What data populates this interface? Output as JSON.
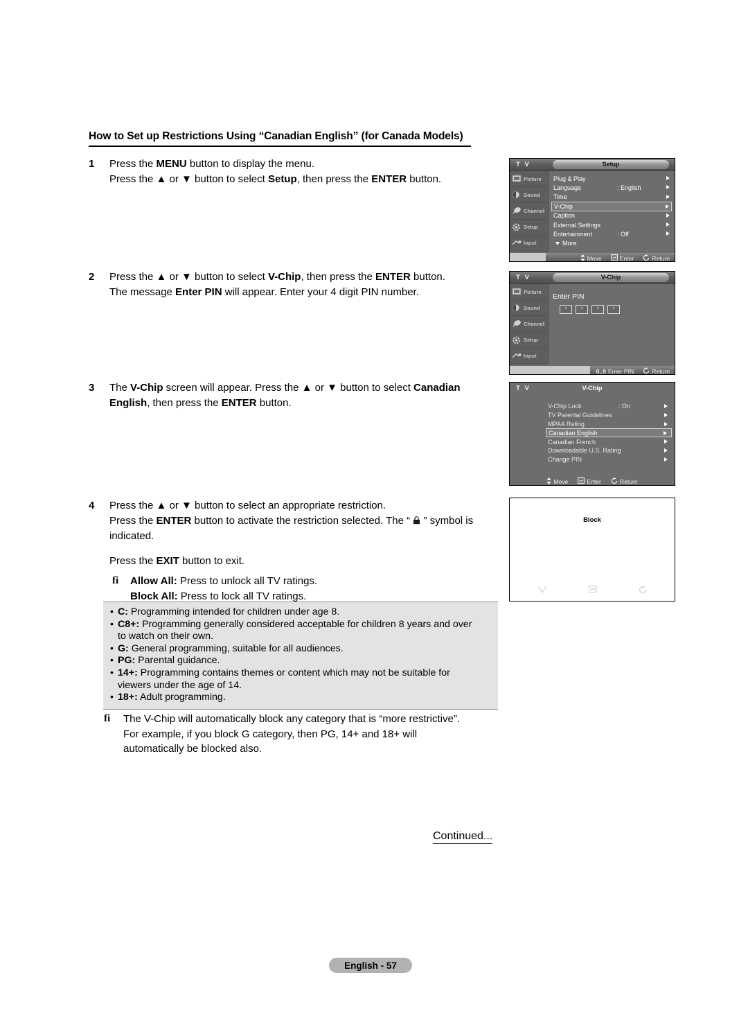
{
  "heading": "How to Set up Restrictions Using “Canadian English” (for Canada Models)",
  "steps": {
    "s1": {
      "num": "1",
      "line1_a": "Press the ",
      "line1_b": "MENU",
      "line1_c": " button to display the menu.",
      "line2_a": "Press the ▲ or ▼ button to select ",
      "line2_b": "Setup",
      "line2_c": ", then press the ",
      "line2_d": "ENTER",
      "line2_e": " button."
    },
    "s2": {
      "num": "2",
      "line1_a": "Press the ▲ or ▼ button to select ",
      "line1_b": "V-Chip",
      "line1_c": ", then press the ",
      "line1_d": "ENTER",
      "line1_e": " button.",
      "line2_a": "The message ",
      "line2_b": "Enter PIN",
      "line2_c": " will appear. Enter your 4 digit PIN number."
    },
    "s3": {
      "num": "3",
      "line1_a": "The ",
      "line1_b": "V-Chip",
      "line1_c": " screen will appear. Press the ▲ or ▼ button to select ",
      "line1_d": "Canadian",
      "line2_a": "English",
      "line2_b": ", then press the ",
      "line2_c": "ENTER",
      "line2_d": " button."
    },
    "s4": {
      "num": "4",
      "line1": "Press the ▲ or ▼ button to select an appropriate restriction.",
      "line2_a": "Press the ",
      "line2_b": "ENTER",
      "line2_c": " button to activate the restriction selected. The “ ",
      "line2_lock": "🔒",
      "line2_d": " ” symbol is",
      "line3": "indicated.",
      "line4_a": "Press the ",
      "line4_b": "EXIT",
      "line4_c": " button to exit.",
      "fi_mark": "fi",
      "allow_label": "Allow All:",
      "allow_text": " Press to unlock all TV ratings.",
      "block_label": "Block All:",
      "block_text": " Press to lock all TV ratings."
    }
  },
  "ratings_note": {
    "bullet": "•",
    "items": [
      {
        "code": "C:",
        "text": " Programming intended for children under age 8."
      },
      {
        "code": "C8+:",
        "text": " Programming generally considered acceptable for children 8 years and over",
        "cont": "to watch on their own."
      },
      {
        "code": "G:",
        "text": " General programming, suitable for all audiences."
      },
      {
        "code": "PG:",
        "text": " Parental guidance."
      },
      {
        "code": "14+:",
        "text": " Programming contains themes or content which may not be suitable for",
        "cont": "viewers under the age of 14."
      },
      {
        "code": "18+:",
        "text": " Adult programming."
      }
    ]
  },
  "final_note": {
    "fi_mark": "fi",
    "line1": "The V-Chip will automatically block any category that is “more restrictive”.",
    "line2": "For example, if you block G category, then PG, 14+ and 18+ will",
    "line3": "automatically be blocked also."
  },
  "continued": "Continued...",
  "footer": {
    "page_label": "English - 57"
  },
  "osd": {
    "tv_label": "T V",
    "sidebar": [
      {
        "name": "Picture",
        "icon": "picture-icon"
      },
      {
        "name": "Sound",
        "icon": "sound-icon"
      },
      {
        "name": "Channel",
        "icon": "channel-icon"
      },
      {
        "name": "Setup",
        "icon": "setup-icon"
      },
      {
        "name": "Input",
        "icon": "input-icon"
      }
    ],
    "panel1": {
      "title": "Setup",
      "rows": [
        {
          "label": "Plug & Play",
          "value": "",
          "selected": false
        },
        {
          "label": "Language",
          "value": ": English",
          "selected": false
        },
        {
          "label": "Time",
          "value": "",
          "selected": false
        },
        {
          "label": "V-Chip",
          "value": "",
          "selected": true
        },
        {
          "label": "Caption",
          "value": "",
          "selected": false
        },
        {
          "label": "External Settings",
          "value": "",
          "selected": false
        },
        {
          "label": "Entertainment",
          "value": ": Off",
          "selected": false
        }
      ],
      "more_label": "More",
      "bottom": [
        {
          "icon": "updown-icon",
          "label": "Move"
        },
        {
          "icon": "enter-icon",
          "label": "Enter"
        },
        {
          "icon": "return-icon",
          "label": "Return"
        }
      ]
    },
    "panel2": {
      "title": "V-Chip",
      "prompt": "Enter PIN",
      "pin_digits": [
        "*",
        "*",
        "*",
        "*"
      ],
      "bottom": [
        {
          "icon": "digits-icon",
          "label": "Enter PIN",
          "prefix": "0..9"
        },
        {
          "icon": "return-icon",
          "label": "Return"
        }
      ]
    },
    "panel3": {
      "title": "V-Chip",
      "rows": [
        {
          "label": "V-Chip Lock",
          "value": ": On",
          "selected": false
        },
        {
          "label": "TV Parental Guidelines",
          "value": "",
          "selected": false
        },
        {
          "label": "MPAA Rating",
          "value": "",
          "selected": false
        },
        {
          "label": "Canadian English",
          "value": "",
          "selected": true
        },
        {
          "label": "Canadian French",
          "value": "",
          "selected": false
        },
        {
          "label": "Downloadable U.S. Rating",
          "value": "",
          "selected": false
        },
        {
          "label": "Change PIN",
          "value": "",
          "selected": false
        }
      ],
      "bottom": [
        {
          "icon": "updown-icon",
          "label": "Move"
        },
        {
          "icon": "enter-icon",
          "label": "Enter"
        },
        {
          "icon": "return-icon",
          "label": "Return"
        }
      ]
    },
    "panel4": {
      "title": "Block",
      "icons": [
        "down-chevron-icon",
        "enter-icon",
        "return-icon"
      ]
    }
  },
  "colors": {
    "osd_bg": "#6d6d6d",
    "osd_sidebar": "#5e5e5e",
    "note_bg": "#e3e3e3",
    "footer_pill": "#b2b2b2"
  }
}
